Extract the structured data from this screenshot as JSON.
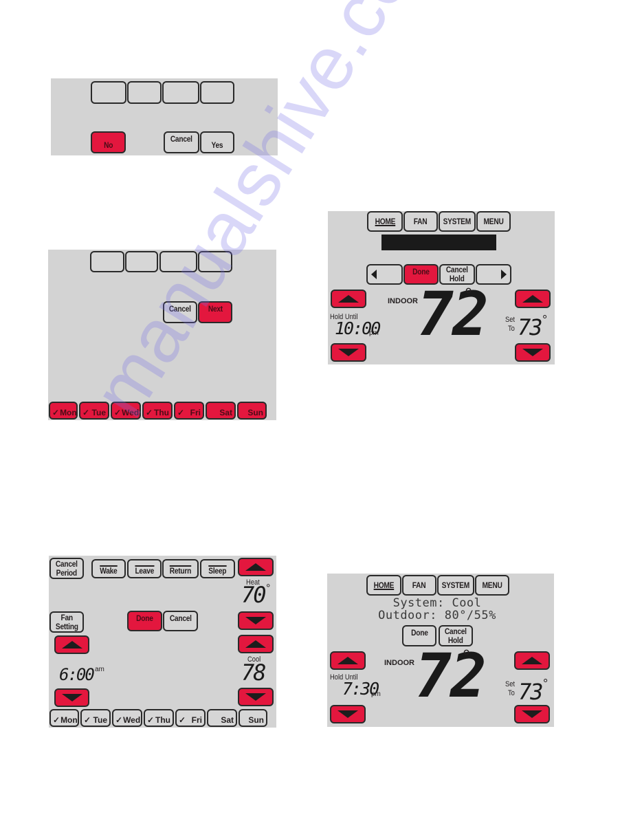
{
  "colors": {
    "accent_red": "#e3173e",
    "panel_bg": "#d3d3d3",
    "button_border": "#2a2a2a",
    "watermark": "#786ee6"
  },
  "panel1": {
    "buttons": {
      "no": "No",
      "cancel": "Cancel",
      "yes": "Yes"
    },
    "blank_tabs": [
      "",
      "",
      "",
      ""
    ]
  },
  "panel2": {
    "buttons": {
      "cancel": "Cancel",
      "next": "Next"
    },
    "days": [
      {
        "label": "Mon",
        "checked": true,
        "selected": true
      },
      {
        "label": "Tue",
        "checked": true,
        "selected": true
      },
      {
        "label": "Wed",
        "checked": true,
        "selected": true
      },
      {
        "label": "Thu",
        "checked": true,
        "selected": true
      },
      {
        "label": "Fri",
        "checked": true,
        "selected": true
      },
      {
        "label": "Sat",
        "checked": false,
        "selected": true
      },
      {
        "label": "Sun",
        "checked": false,
        "selected": true
      }
    ]
  },
  "panel3": {
    "tabs": {
      "home": "HOME",
      "fan": "FAN",
      "system": "SYSTEM",
      "menu": "MENU"
    },
    "buttons": {
      "done": "Done",
      "cancel_hold_1": "Cancel",
      "cancel_hold_2": "Hold"
    },
    "indoor_label": "INDOOR",
    "indoor_temp": "72",
    "degree": "°",
    "hold_until_label": "Hold Until",
    "hold_time": "10:00",
    "hold_ampm": "pm",
    "set_to_1": "Set",
    "set_to_2": "To",
    "set_temp": "73"
  },
  "panel4": {
    "buttons": {
      "cancel_period_1": "Cancel",
      "cancel_period_2": "Period",
      "wake": "Wake",
      "leave": "Leave",
      "return": "Return",
      "sleep": "Sleep",
      "fan_setting_1": "Fan",
      "fan_setting_2": "Setting",
      "done": "Done",
      "cancel": "Cancel"
    },
    "heat_label": "Heat",
    "heat_temp": "70",
    "cool_label": "Cool",
    "cool_temp": "78",
    "degree": "°",
    "time": "6:00",
    "ampm": "am",
    "days": [
      {
        "label": "Mon",
        "checked": true,
        "selected": false
      },
      {
        "label": "Tue",
        "checked": true,
        "selected": false
      },
      {
        "label": "Wed",
        "checked": true,
        "selected": false
      },
      {
        "label": "Thu",
        "checked": true,
        "selected": false
      },
      {
        "label": "Fri",
        "checked": true,
        "selected": false
      },
      {
        "label": "Sat",
        "checked": false,
        "selected": false
      },
      {
        "label": "Sun",
        "checked": false,
        "selected": false
      }
    ]
  },
  "panel5": {
    "tabs": {
      "home": "HOME",
      "fan": "FAN",
      "system": "SYSTEM",
      "menu": "MENU"
    },
    "status_line1": "System: Cool",
    "status_line2": "Outdoor: 80°/55%",
    "buttons": {
      "done": "Done",
      "cancel_hold_1": "Cancel",
      "cancel_hold_2": "Hold"
    },
    "indoor_label": "INDOOR",
    "indoor_temp": "72",
    "degree": "°",
    "hold_until_label": "Hold Until",
    "hold_time": "7:30",
    "hold_ampm": "pm",
    "set_to_1": "Set",
    "set_to_2": "To",
    "set_temp": "73"
  },
  "watermark": "manualshive.com",
  "check_glyph": "✓"
}
